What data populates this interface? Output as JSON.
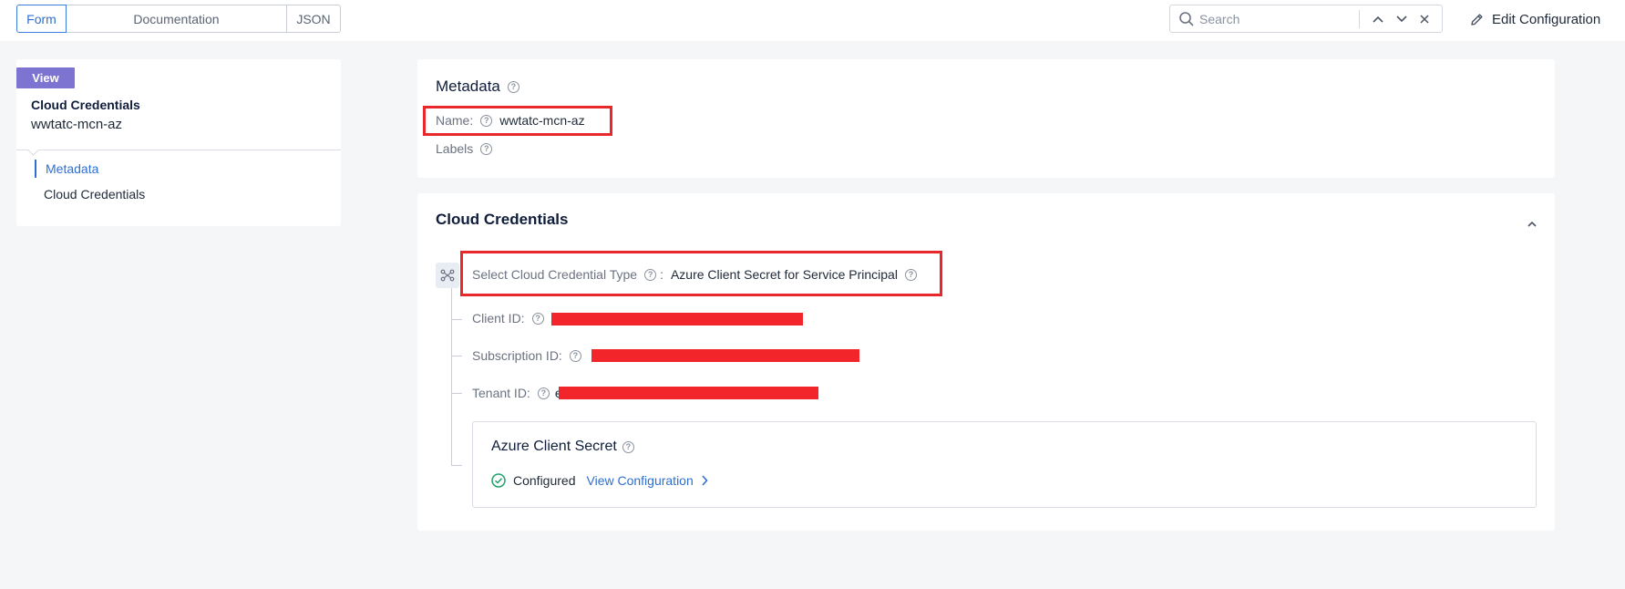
{
  "toolbar": {
    "tabs": [
      "Form",
      "Documentation",
      "JSON"
    ],
    "search_placeholder": "Search",
    "edit_configuration": "Edit Configuration"
  },
  "sidebar": {
    "badge": "View",
    "title": "Cloud Credentials",
    "subtitle": "wwtatc-mcn-az",
    "nav": [
      "Metadata",
      "Cloud Credentials"
    ]
  },
  "metadata": {
    "title": "Metadata",
    "name_label": "Name:",
    "name_value": "wwtatc-mcn-az",
    "labels_label": "Labels"
  },
  "cloud_credentials": {
    "title": "Cloud Credentials",
    "type_label": "Select Cloud Credential Type",
    "type_sep": ":",
    "type_value": "Azure Client Secret for Service Principal",
    "client_id_label": "Client ID:",
    "subscription_id_label": "Subscription ID:",
    "tenant_id_label": "Tenant ID:",
    "tenant_id_prefix": "e",
    "secret": {
      "title": "Azure Client Secret",
      "status": "Configured",
      "view_link": "View Configuration"
    }
  },
  "colors": {
    "accent": "#2f6fd1",
    "badge": "#7d74d1",
    "highlight": "#e8282b",
    "success": "#22a06b"
  }
}
